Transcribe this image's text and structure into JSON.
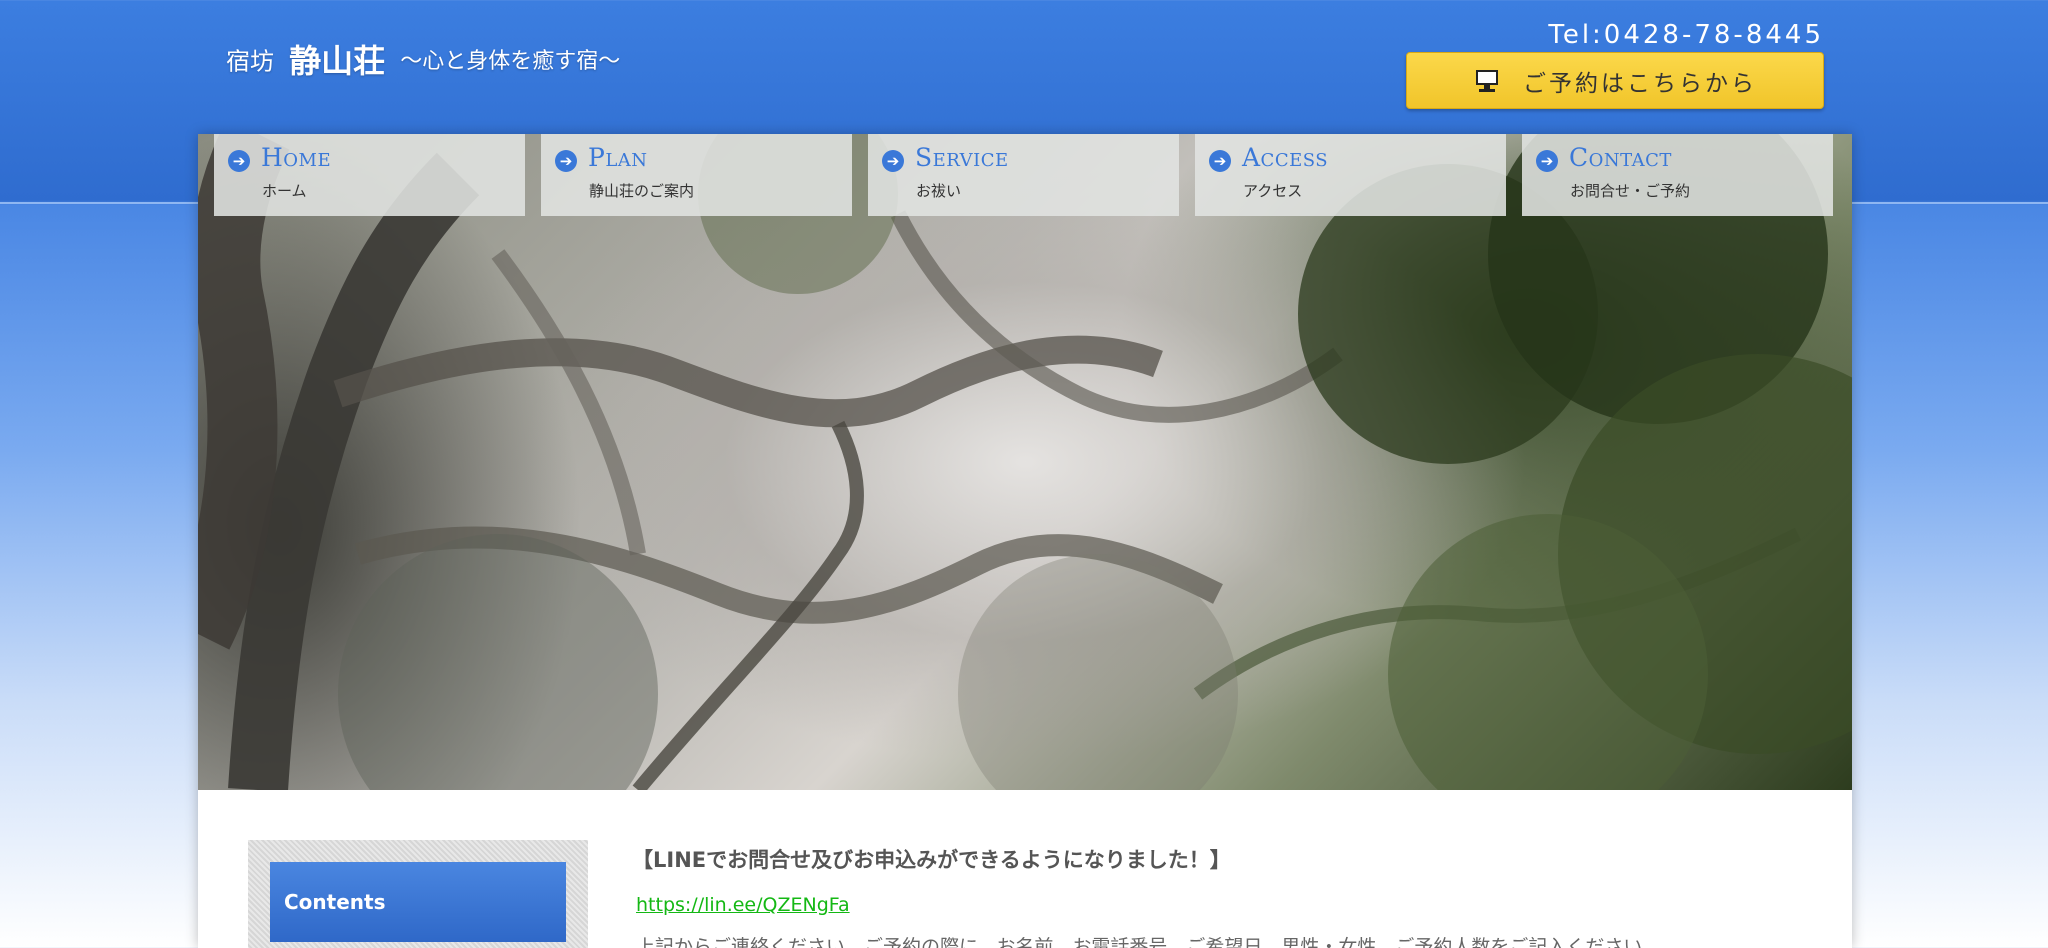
{
  "header": {
    "site_prefix": "宿坊",
    "site_name": "静山荘",
    "tagline": "～心と身体を癒す宿～",
    "tel": "Tel:0428-78-8445",
    "reserve_button": "ご予約はこちらから"
  },
  "nav": [
    {
      "en": "Home",
      "jp": "ホーム"
    },
    {
      "en": "Plan",
      "jp": "静山荘のご案内"
    },
    {
      "en": "Service",
      "jp": "お祓い"
    },
    {
      "en": "Access",
      "jp": "アクセス"
    },
    {
      "en": "Contact",
      "jp": "お問合せ・ご予約"
    }
  ],
  "sidebar": {
    "contents_label": "Contents"
  },
  "main": {
    "headline": "【LINEでお問合せ及びお申込みができるようになりました！】",
    "line_link": "https://lin.ee/QZENgFa",
    "body_text": "上記からご連絡ください。ご予約の際に、お名前、お電話番号、ご希望日、男性・女性、ご予約人数をご記入ください。"
  },
  "colors": {
    "header_blue": "#3c7ee0",
    "nav_text": "#3a78d8",
    "button_yellow": "#f6cd36",
    "link_green": "#14b814"
  },
  "icons": {
    "reserve_button": "computer-icon",
    "nav_arrow": "arrow-right-circle-icon"
  }
}
